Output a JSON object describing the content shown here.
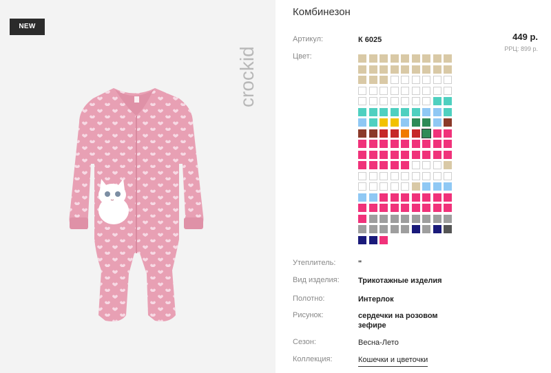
{
  "badge": "NEW",
  "brand": "crockid",
  "product": {
    "title": "Комбинезон",
    "price": "449 р.",
    "rrp": "РРЦ: 899 р."
  },
  "attributes": {
    "article": {
      "label": "Артикул:",
      "value": "К 6025"
    },
    "color": {
      "label": "Цвет:"
    },
    "insulation": {
      "label": "Утеплитель:",
      "value": "\""
    },
    "type": {
      "label": "Вид изделия:",
      "value": "Трикотажные изделия"
    },
    "fabric": {
      "label": "Полотно:",
      "value": "Интерлок"
    },
    "pattern": {
      "label": "Рисунок:",
      "value": "сердечки на розовом зефире"
    },
    "season": {
      "label": "Сезон:",
      "value": "Весна-Лето"
    },
    "collection": {
      "label": "Коллекция:",
      "value": "Кошечки и цветочки"
    }
  },
  "swatch_colors": {
    "B": "#d9c9a6",
    "W": "#ffffff",
    "T": "#4fd0c0",
    "L": "#8fc8f4",
    "Y": "#f2c200",
    "G": "#2e8b57",
    "K": "#8b3a2a",
    "R": "#c62828",
    "O": "#f07a00",
    "P": "#f0327a",
    "S": "#9e9e9e",
    "D": "#555555",
    "N": "#1a1a7a"
  },
  "swatch_rows": [
    "BBBBBBBBB",
    "BBBBBBBBB",
    "BBBWWWWWW",
    "WWWWWWWWW",
    "WWWWWWWTT",
    "TTTTTTLLT",
    "LTYYLGGLK",
    "KKRRORGPP",
    "PPPPPPPPP",
    "PPPPPPPPP",
    "PPPPPWWWB",
    "WWWWWWWWW",
    "WWWWWBLLL",
    "LLPPPPPPP",
    "PPPPPPPPP",
    "PSSSSSSSS",
    "SSSSSNSND",
    "NNP"
  ],
  "selected_swatch": "7.6"
}
